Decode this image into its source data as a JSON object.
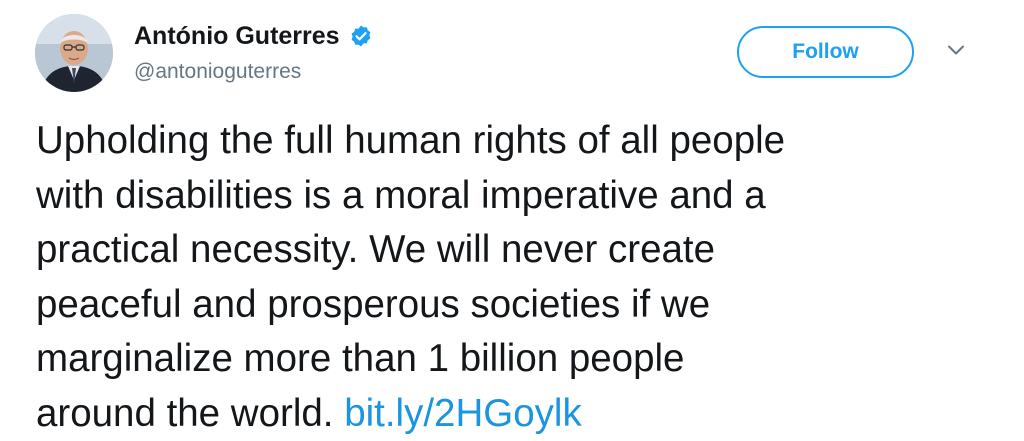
{
  "author": {
    "display_name": "António Guterres",
    "handle": "@antonioguterres",
    "verified": true,
    "avatar_icon": "profile-photo-avatar"
  },
  "actions": {
    "follow_label": "Follow",
    "menu_icon": "chevron-down-icon"
  },
  "tweet": {
    "lines": [
      "Upholding the full human rights of all people",
      "with disabilities is a moral imperative and a",
      "practical necessity. We will never create",
      "peaceful and prosperous societies if we",
      "marginalize more than 1 billion people",
      "around the world. "
    ],
    "link_text": "bit.ly/2HGoylk"
  },
  "colors": {
    "accent": "#1da1f2",
    "link": "#1b95e0",
    "text": "#14171a",
    "secondary_text": "#657786"
  }
}
